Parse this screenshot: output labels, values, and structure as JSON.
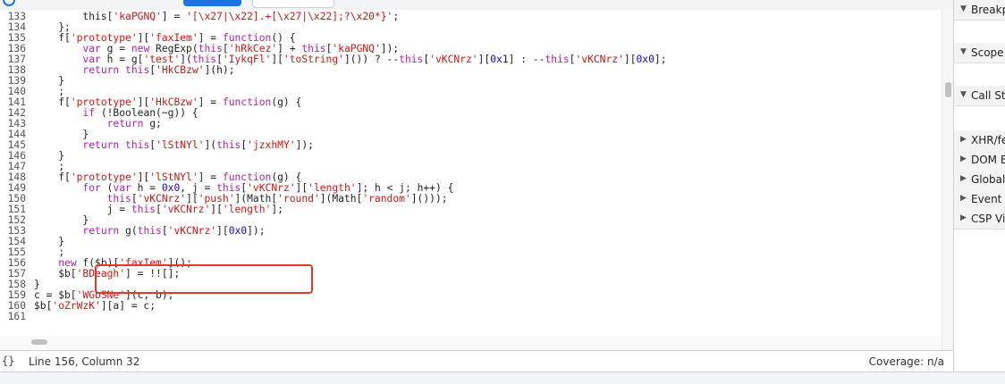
{
  "lines": [
    {
      "n": "133",
      "tokens": [
        [
          "p",
          "        "
        ],
        [
          "p",
          "this["
        ],
        [
          "s",
          "'kaPGNQ'"
        ],
        [
          "p",
          "] = "
        ],
        [
          "s",
          "'[\\x27|\\x22].+[\\x27|\\x22];?\\x20*}'"
        ],
        [
          "p",
          ";"
        ]
      ]
    },
    {
      "n": "134",
      "tokens": [
        [
          "p",
          "    };"
        ]
      ]
    },
    {
      "n": "135",
      "tokens": [
        [
          "p",
          "    f["
        ],
        [
          "s",
          "'prototype'"
        ],
        [
          "p",
          "]["
        ],
        [
          "s",
          "'faxIem'"
        ],
        [
          "p",
          "] = "
        ],
        [
          "k",
          "function"
        ],
        [
          "p",
          "() {"
        ]
      ]
    },
    {
      "n": "136",
      "tokens": [
        [
          "p",
          "        "
        ],
        [
          "k",
          "var"
        ],
        [
          "p",
          " g = "
        ],
        [
          "k",
          "new"
        ],
        [
          "p",
          " RegExp("
        ],
        [
          "k",
          "this"
        ],
        [
          "p",
          "["
        ],
        [
          "s",
          "'hRkCez'"
        ],
        [
          "p",
          "] + "
        ],
        [
          "k",
          "this"
        ],
        [
          "p",
          "["
        ],
        [
          "s",
          "'kaPGNQ'"
        ],
        [
          "p",
          "]);"
        ]
      ]
    },
    {
      "n": "137",
      "tokens": [
        [
          "p",
          "        "
        ],
        [
          "k",
          "var"
        ],
        [
          "p",
          " h = g["
        ],
        [
          "s",
          "'test'"
        ],
        [
          "p",
          "]("
        ],
        [
          "k",
          "this"
        ],
        [
          "p",
          "["
        ],
        [
          "s",
          "'IykqFl'"
        ],
        [
          "p",
          "]["
        ],
        [
          "s",
          "'toString'"
        ],
        [
          "p",
          "]()) ? --"
        ],
        [
          "k",
          "this"
        ],
        [
          "p",
          "["
        ],
        [
          "s",
          "'vKCNrz'"
        ],
        [
          "p",
          "]["
        ],
        [
          "n",
          "0x1"
        ],
        [
          "p",
          "] : --"
        ],
        [
          "k",
          "this"
        ],
        [
          "p",
          "["
        ],
        [
          "s",
          "'vKCNrz'"
        ],
        [
          "p",
          "]["
        ],
        [
          "n",
          "0x0"
        ],
        [
          "p",
          "];"
        ]
      ]
    },
    {
      "n": "138",
      "tokens": [
        [
          "p",
          "        "
        ],
        [
          "k",
          "return"
        ],
        [
          "p",
          " "
        ],
        [
          "k",
          "this"
        ],
        [
          "p",
          "["
        ],
        [
          "s",
          "'HkCBzw'"
        ],
        [
          "p",
          "](h);"
        ]
      ]
    },
    {
      "n": "139",
      "tokens": [
        [
          "p",
          "    }"
        ]
      ]
    },
    {
      "n": "140",
      "tokens": [
        [
          "p",
          "    ;"
        ]
      ]
    },
    {
      "n": "141",
      "tokens": [
        [
          "p",
          "    f["
        ],
        [
          "s",
          "'prototype'"
        ],
        [
          "p",
          "]["
        ],
        [
          "s",
          "'HkCBzw'"
        ],
        [
          "p",
          "] = "
        ],
        [
          "k",
          "function"
        ],
        [
          "p",
          "(g) {"
        ]
      ]
    },
    {
      "n": "142",
      "tokens": [
        [
          "p",
          "        "
        ],
        [
          "k",
          "if"
        ],
        [
          "p",
          " (!Boolean(~g)) {"
        ]
      ]
    },
    {
      "n": "143",
      "tokens": [
        [
          "p",
          "            "
        ],
        [
          "k",
          "return"
        ],
        [
          "p",
          " g;"
        ]
      ]
    },
    {
      "n": "144",
      "tokens": [
        [
          "p",
          "        }"
        ]
      ]
    },
    {
      "n": "145",
      "tokens": [
        [
          "p",
          "        "
        ],
        [
          "k",
          "return"
        ],
        [
          "p",
          " "
        ],
        [
          "k",
          "this"
        ],
        [
          "p",
          "["
        ],
        [
          "s",
          "'lStNYl'"
        ],
        [
          "p",
          "]("
        ],
        [
          "k",
          "this"
        ],
        [
          "p",
          "["
        ],
        [
          "s",
          "'jzxhMY'"
        ],
        [
          "p",
          "]);"
        ]
      ]
    },
    {
      "n": "146",
      "tokens": [
        [
          "p",
          "    }"
        ]
      ]
    },
    {
      "n": "147",
      "tokens": [
        [
          "p",
          "    ;"
        ]
      ]
    },
    {
      "n": "148",
      "tokens": [
        [
          "p",
          "    f["
        ],
        [
          "s",
          "'prototype'"
        ],
        [
          "p",
          "]["
        ],
        [
          "s",
          "'lStNYl'"
        ],
        [
          "p",
          "] = "
        ],
        [
          "k",
          "function"
        ],
        [
          "p",
          "(g) {"
        ]
      ]
    },
    {
      "n": "149",
      "tokens": [
        [
          "p",
          "        "
        ],
        [
          "k",
          "for"
        ],
        [
          "p",
          " ("
        ],
        [
          "k",
          "var"
        ],
        [
          "p",
          " h = "
        ],
        [
          "n",
          "0x0"
        ],
        [
          "p",
          ", j = "
        ],
        [
          "k",
          "this"
        ],
        [
          "p",
          "["
        ],
        [
          "s",
          "'vKCNrz'"
        ],
        [
          "p",
          "]["
        ],
        [
          "s",
          "'length'"
        ],
        [
          "p",
          "]; h < j; h++) {"
        ]
      ]
    },
    {
      "n": "150",
      "tokens": [
        [
          "p",
          "            "
        ],
        [
          "k",
          "this"
        ],
        [
          "p",
          "["
        ],
        [
          "s",
          "'vKCNrz'"
        ],
        [
          "p",
          "]["
        ],
        [
          "s",
          "'push'"
        ],
        [
          "p",
          "](Math["
        ],
        [
          "s",
          "'round'"
        ],
        [
          "p",
          "](Math["
        ],
        [
          "s",
          "'random'"
        ],
        [
          "p",
          "]()));"
        ]
      ]
    },
    {
      "n": "151",
      "tokens": [
        [
          "p",
          "            j = "
        ],
        [
          "k",
          "this"
        ],
        [
          "p",
          "["
        ],
        [
          "s",
          "'vKCNrz'"
        ],
        [
          "p",
          "]["
        ],
        [
          "s",
          "'length'"
        ],
        [
          "p",
          "];"
        ]
      ]
    },
    {
      "n": "152",
      "tokens": [
        [
          "p",
          "        }"
        ]
      ]
    },
    {
      "n": "153",
      "tokens": [
        [
          "p",
          "        "
        ],
        [
          "k",
          "return"
        ],
        [
          "p",
          " g("
        ],
        [
          "k",
          "this"
        ],
        [
          "p",
          "["
        ],
        [
          "s",
          "'vKCNrz'"
        ],
        [
          "p",
          "]["
        ],
        [
          "n",
          "0x0"
        ],
        [
          "p",
          "]);"
        ]
      ]
    },
    {
      "n": "154",
      "tokens": [
        [
          "p",
          "    }"
        ]
      ]
    },
    {
      "n": "155",
      "tokens": [
        [
          "p",
          "    ;"
        ]
      ]
    },
    {
      "n": "156",
      "tokens": [
        [
          "p",
          "    "
        ],
        [
          "k",
          "new"
        ],
        [
          "p",
          " f($b)["
        ],
        [
          "s",
          "'faxIem'"
        ],
        [
          "p",
          "]();"
        ]
      ]
    },
    {
      "n": "157",
      "tokens": [
        [
          "p",
          "    $b["
        ],
        [
          "s",
          "'BDeagh'"
        ],
        [
          "p",
          "] = !![];"
        ]
      ]
    },
    {
      "n": "158",
      "tokens": [
        [
          "p",
          "}"
        ]
      ]
    },
    {
      "n": "159",
      "tokens": [
        [
          "p",
          "c = $b["
        ],
        [
          "s",
          "'WGbSNe'"
        ],
        [
          "p",
          "](c, b);"
        ]
      ]
    },
    {
      "n": "160",
      "tokens": [
        [
          "p",
          "$b["
        ],
        [
          "s",
          "'oZrWzK'"
        ],
        [
          "p",
          "][a] = c;"
        ]
      ]
    },
    {
      "n": "161",
      "tokens": []
    }
  ],
  "status": {
    "braces": "{}",
    "position": "Line 156, Column 32",
    "coverage": "Coverage: n/a"
  },
  "sidebar": [
    {
      "label": "Breakpoints",
      "icon": "triangle-down-icon"
    },
    {
      "label": "Scope",
      "icon": "triangle-down-icon"
    },
    {
      "label": "Call Stack",
      "icon": "triangle-down-icon"
    },
    {
      "label": "XHR/fetch Breakpoints",
      "icon": "triangle-right-icon"
    },
    {
      "label": "DOM Breakpoints",
      "icon": "triangle-right-icon"
    },
    {
      "label": "Global Listeners",
      "icon": "triangle-right-icon"
    },
    {
      "label": "Event Listener Breakpoints",
      "icon": "triangle-right-icon"
    },
    {
      "label": "CSP Violation Breakpoints",
      "icon": "triangle-right-icon"
    }
  ],
  "colors": {
    "keyword": "#a626a4",
    "string": "#c41a16",
    "number": "#1c00cf",
    "highlight_box": "#e1372f"
  }
}
